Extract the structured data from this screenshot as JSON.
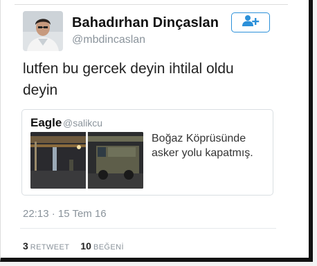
{
  "author": {
    "name": "Bahadırhan Dinçaslan",
    "handle": "@mbdincaslan"
  },
  "tweet": {
    "text": "lutfen bu gercek deyin ihtilal oldu deyin",
    "timestamp": "22:13 · 15 Tem 16"
  },
  "quoted": {
    "name": "Eagle",
    "handle": "@salikcu",
    "text": "Boğaz Köprüsünde asker yolu kapatmış."
  },
  "stats": {
    "retweets_count": "3",
    "retweets_label": "RETWEET",
    "likes_count": "10",
    "likes_label": "BEĞENİ"
  },
  "colors": {
    "accent": "#2b90d9",
    "muted": "#8a939b"
  },
  "icons": {
    "follow": "add-user-icon"
  }
}
